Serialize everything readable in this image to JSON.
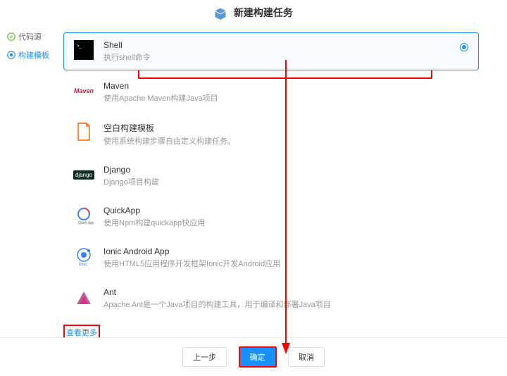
{
  "header": {
    "title": "新建构建任务"
  },
  "sidebar": {
    "items": [
      {
        "label": "代码源",
        "state": "done"
      },
      {
        "label": "构建模板",
        "state": "active"
      }
    ]
  },
  "templates": [
    {
      "id": "shell",
      "title": "Shell",
      "desc": "执行shell命令",
      "selected": true
    },
    {
      "id": "maven",
      "title": "Maven",
      "desc": "使用Apache Maven构建Java项目",
      "selected": false
    },
    {
      "id": "blank",
      "title": "空白构建模板",
      "desc": "使用系统构建步骤自由定义构建任务。",
      "selected": false
    },
    {
      "id": "django",
      "title": "Django",
      "desc": "Django项目构建",
      "selected": false
    },
    {
      "id": "quickapp",
      "title": "QuickApp",
      "desc": "使用Npm构建quickapp快应用",
      "selected": false
    },
    {
      "id": "ionic",
      "title": "Ionic Android App",
      "desc": "使用HTML5应用程序开发框架Ionic开发Android应用",
      "selected": false
    },
    {
      "id": "ant",
      "title": "Ant",
      "desc": "Apache Ant是一个Java项目的构建工具，用于编译和部署Java项目",
      "selected": false
    }
  ],
  "more_label": "查看更多",
  "footer": {
    "prev": "上一步",
    "ok": "确定",
    "cancel": "取消"
  }
}
